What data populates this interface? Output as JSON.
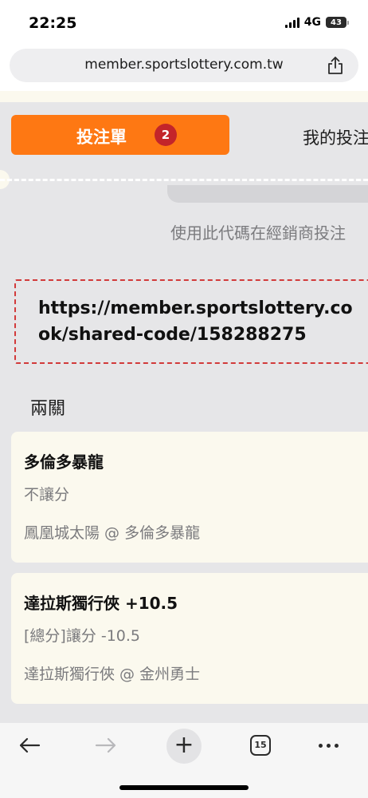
{
  "status_bar": {
    "time": "22:25",
    "network": "4G",
    "battery": "43"
  },
  "browser": {
    "url": "member.sportslottery.com.tw",
    "open_tabs_count": "15"
  },
  "tabs": {
    "active_label": "投注單",
    "active_badge": "2",
    "other_label": "我的投注"
  },
  "slip": {
    "instruction": "使用此代碼在經銷商投注",
    "share_url_line1": "https://member.sportslottery.co",
    "share_url_line2": "ok/shared-code/158288275",
    "bet_type": "兩關",
    "selections": [
      {
        "team": "多倫多暴龍",
        "market": "不讓分",
        "match": "鳳凰城太陽 @ 多倫多暴龍"
      },
      {
        "team": "達拉斯獨行俠 +10.5",
        "market": "[總分]讓分 -10.5",
        "match": "達拉斯獨行俠 @ 金州勇士"
      }
    ]
  },
  "icons": {
    "share": "share-icon",
    "back": "back-arrow-icon",
    "forward": "forward-arrow-icon",
    "new_tab": "plus-icon",
    "tabs": "tabs-icon",
    "more": "more-icon"
  },
  "colors": {
    "accent": "#fe7813",
    "badge": "#c3252a",
    "dashed_border": "#d23a3a",
    "panel": "#e6e6e8",
    "card": "#fbf9ee"
  }
}
